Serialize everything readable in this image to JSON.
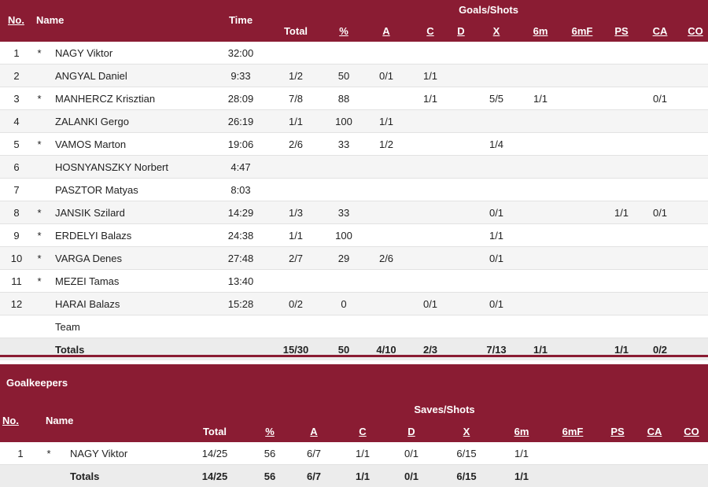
{
  "players_table": {
    "headers": {
      "no": "No.",
      "name": "Name",
      "time": "Time",
      "group": "Goals/Shots",
      "total": "Total",
      "pct": "%",
      "a": "A",
      "c": "C",
      "d": "D",
      "x": "X",
      "m6": "6m",
      "m6f": "6mF",
      "ps": "PS",
      "ca": "CA",
      "co": "CO"
    },
    "rows": [
      {
        "no": "1",
        "star": "*",
        "name": "NAGY Viktor",
        "time": "32:00",
        "total": "",
        "pct": "",
        "a": "",
        "c": "",
        "d": "",
        "x": "",
        "m6": "",
        "m6f": "",
        "ps": "",
        "ca": "",
        "co": ""
      },
      {
        "no": "2",
        "star": "",
        "name": "ANGYAL Daniel",
        "time": "9:33",
        "total": "1/2",
        "pct": "50",
        "a": "0/1",
        "c": "1/1",
        "d": "",
        "x": "",
        "m6": "",
        "m6f": "",
        "ps": "",
        "ca": "",
        "co": ""
      },
      {
        "no": "3",
        "star": "*",
        "name": "MANHERCZ Krisztian",
        "time": "28:09",
        "total": "7/8",
        "pct": "88",
        "a": "",
        "c": "1/1",
        "d": "",
        "x": "5/5",
        "m6": "1/1",
        "m6f": "",
        "ps": "",
        "ca": "0/1",
        "co": ""
      },
      {
        "no": "4",
        "star": "",
        "name": "ZALANKI Gergo",
        "time": "26:19",
        "total": "1/1",
        "pct": "100",
        "a": "1/1",
        "c": "",
        "d": "",
        "x": "",
        "m6": "",
        "m6f": "",
        "ps": "",
        "ca": "",
        "co": ""
      },
      {
        "no": "5",
        "star": "*",
        "name": "VAMOS Marton",
        "time": "19:06",
        "total": "2/6",
        "pct": "33",
        "a": "1/2",
        "c": "",
        "d": "",
        "x": "1/4",
        "m6": "",
        "m6f": "",
        "ps": "",
        "ca": "",
        "co": ""
      },
      {
        "no": "6",
        "star": "",
        "name": "HOSNYANSZKY Norbert",
        "time": "4:47",
        "total": "",
        "pct": "",
        "a": "",
        "c": "",
        "d": "",
        "x": "",
        "m6": "",
        "m6f": "",
        "ps": "",
        "ca": "",
        "co": ""
      },
      {
        "no": "7",
        "star": "",
        "name": "PASZTOR Matyas",
        "time": "8:03",
        "total": "",
        "pct": "",
        "a": "",
        "c": "",
        "d": "",
        "x": "",
        "m6": "",
        "m6f": "",
        "ps": "",
        "ca": "",
        "co": ""
      },
      {
        "no": "8",
        "star": "*",
        "name": "JANSIK Szilard",
        "time": "14:29",
        "total": "1/3",
        "pct": "33",
        "a": "",
        "c": "",
        "d": "",
        "x": "0/1",
        "m6": "",
        "m6f": "",
        "ps": "1/1",
        "ca": "0/1",
        "co": ""
      },
      {
        "no": "9",
        "star": "*",
        "name": "ERDELYI Balazs",
        "time": "24:38",
        "total": "1/1",
        "pct": "100",
        "a": "",
        "c": "",
        "d": "",
        "x": "1/1",
        "m6": "",
        "m6f": "",
        "ps": "",
        "ca": "",
        "co": ""
      },
      {
        "no": "10",
        "star": "*",
        "name": "VARGA Denes",
        "time": "27:48",
        "total": "2/7",
        "pct": "29",
        "a": "2/6",
        "c": "",
        "d": "",
        "x": "0/1",
        "m6": "",
        "m6f": "",
        "ps": "",
        "ca": "",
        "co": ""
      },
      {
        "no": "11",
        "star": "*",
        "name": "MEZEI Tamas",
        "time": "13:40",
        "total": "",
        "pct": "",
        "a": "",
        "c": "",
        "d": "",
        "x": "",
        "m6": "",
        "m6f": "",
        "ps": "",
        "ca": "",
        "co": ""
      },
      {
        "no": "12",
        "star": "",
        "name": "HARAI Balazs",
        "time": "15:28",
        "total": "0/2",
        "pct": "0",
        "a": "",
        "c": "0/1",
        "d": "",
        "x": "0/1",
        "m6": "",
        "m6f": "",
        "ps": "",
        "ca": "",
        "co": ""
      },
      {
        "no": "",
        "star": "",
        "name": "Team",
        "time": "",
        "total": "",
        "pct": "",
        "a": "",
        "c": "",
        "d": "",
        "x": "",
        "m6": "",
        "m6f": "",
        "ps": "",
        "ca": "",
        "co": ""
      }
    ],
    "totals": {
      "label": "Totals",
      "total": "15/30",
      "pct": "50",
      "a": "4/10",
      "c": "2/3",
      "d": "",
      "x": "7/13",
      "m6": "1/1",
      "m6f": "",
      "ps": "1/1",
      "ca": "0/2",
      "co": ""
    }
  },
  "goalkeepers_table": {
    "title": "Goalkeepers",
    "headers": {
      "no": "No.",
      "name": "Name",
      "group": "Saves/Shots",
      "total": "Total",
      "pct": "%",
      "a": "A",
      "c": "C",
      "d": "D",
      "x": "X",
      "m6": "6m",
      "m6f": "6mF",
      "ps": "PS",
      "ca": "CA",
      "co": "CO"
    },
    "rows": [
      {
        "no": "1",
        "star": "*",
        "name": "NAGY Viktor",
        "total": "14/25",
        "pct": "56",
        "a": "6/7",
        "c": "1/1",
        "d": "0/1",
        "x": "6/15",
        "m6": "1/1",
        "m6f": "",
        "ps": "",
        "ca": "",
        "co": ""
      }
    ],
    "totals": {
      "label": "Totals",
      "total": "14/25",
      "pct": "56",
      "a": "6/7",
      "c": "1/1",
      "d": "0/1",
      "x": "6/15",
      "m6": "1/1",
      "m6f": "",
      "ps": "",
      "ca": "",
      "co": ""
    }
  },
  "colors": {
    "header_bg": "#8a1c33",
    "header_text": "#ffffff",
    "row_alt": "#f5f5f5",
    "totals_bg": "#ececec"
  }
}
